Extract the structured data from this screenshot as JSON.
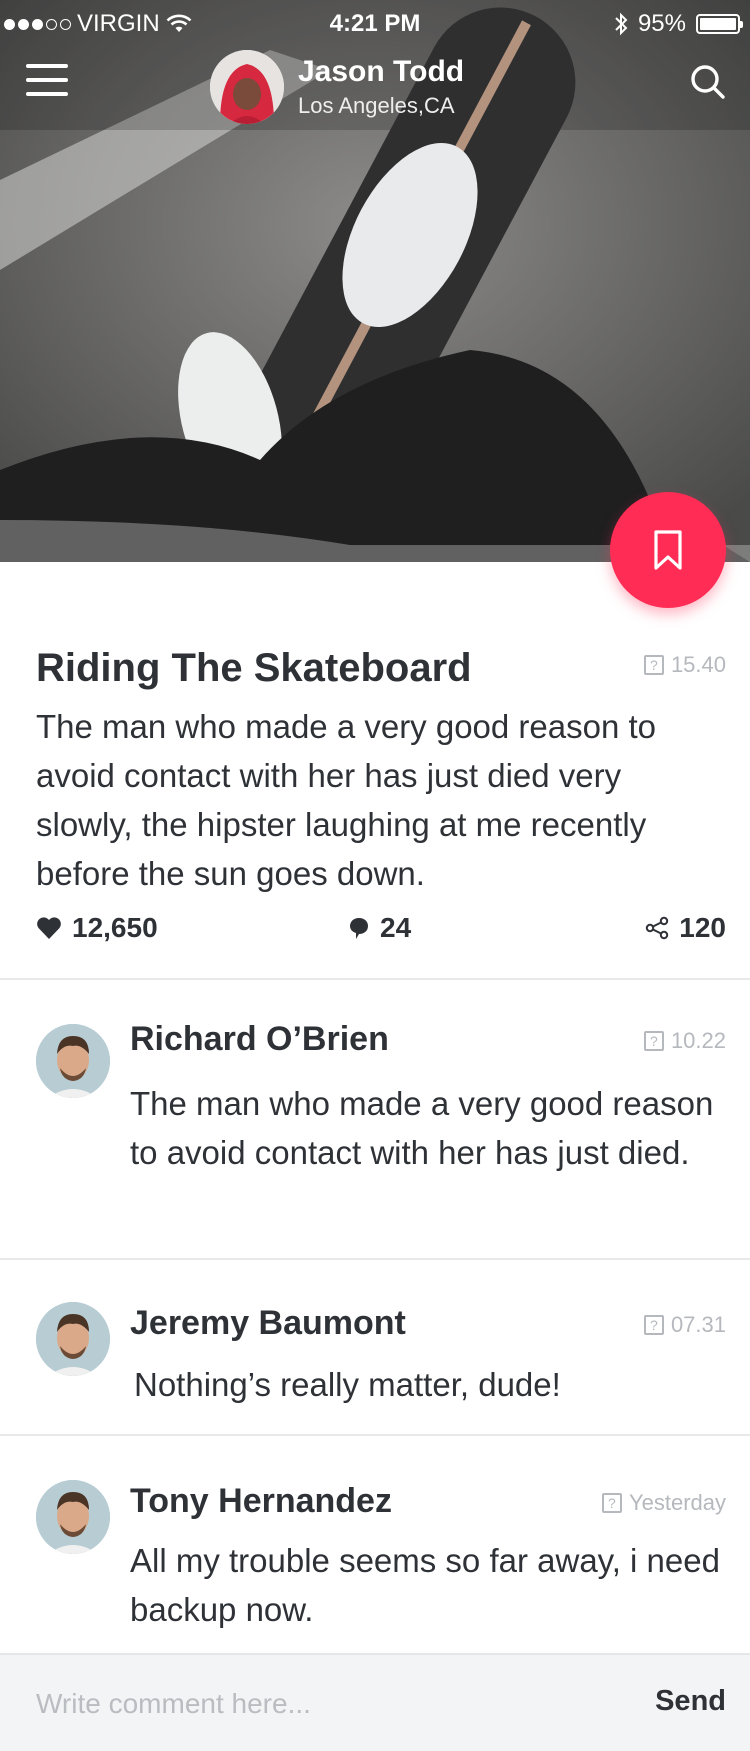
{
  "status_bar": {
    "carrier": "VIRGIN",
    "time": "4:21 PM",
    "battery": "95%",
    "battery_level": 0.95,
    "signal_bars": 3,
    "signal_total": 5
  },
  "profile": {
    "name": "Jason Todd",
    "location": "Los Angeles,CA"
  },
  "post": {
    "title": "Riding The Skateboard",
    "time": "15.40",
    "body": "The man who made a very good reason to avoid contact with her has just died very slowly, the hipster laughing at me recently before the sun goes down.",
    "likes": "12,650",
    "comments": "24",
    "shares": "120"
  },
  "comments": [
    {
      "name": "Richard O’Brien",
      "time": "10.22",
      "text": "The man who made a very good reason to avoid contact with her has just died."
    },
    {
      "name": "Jeremy Baumont",
      "time": "07.31",
      "text": "Nothing’s really matter, dude!"
    },
    {
      "name": "Tony Hernandez",
      "time": "Yesterday",
      "text": "All my trouble seems so far away, i need backup now."
    }
  ],
  "composer": {
    "placeholder": "Write comment here...",
    "send_label": "Send"
  },
  "colors": {
    "accent": "#ff2d55",
    "text": "#2e3237",
    "muted": "#b5b8bd"
  },
  "icons": {
    "menu": "hamburger-menu-icon",
    "search": "search-icon",
    "bookmark": "bookmark-icon",
    "like": "heart-icon",
    "comment": "speech-bubble-icon",
    "share": "share-icon",
    "time": "question-box-icon"
  }
}
